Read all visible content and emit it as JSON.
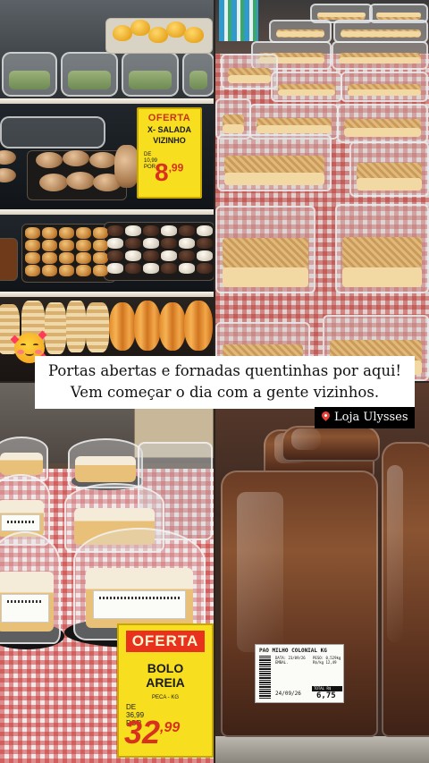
{
  "story": {
    "caption_line1": "Portas abertas e fornadas quentinhas por aqui!",
    "caption_line2": "Vem começar o dia com a gente vizinhos.",
    "location_label": "Loja Ulysses",
    "emoji": "smiling-face-with-hearts"
  },
  "tag_salada": {
    "offer": "OFERTA",
    "name_line1": "X- SALADA",
    "name_line2": "VIZINHO",
    "old_line1": "DE",
    "old_price": "10,99",
    "old_line3": "POR",
    "price_int": "8",
    "price_cents": ",99"
  },
  "tag_bolo": {
    "offer": "OFERTA",
    "name_line1": "BOLO",
    "name_line2": "AREIA",
    "unit": "PECA - KG",
    "old_line1": "DE",
    "old_price": "36,99",
    "old_line3": "POR",
    "price_int": "32",
    "price_cents": ",99"
  },
  "bread_label": {
    "product": "PAO MILHO COLONIAL KG",
    "info_left": "DATA: 23/09/26 EMBAL.",
    "info_right": "PESO: 0,529kg R$/kg 12,49",
    "total_label": "TOTAL R$",
    "total": "6,75",
    "date": "24/09/26"
  },
  "colors": {
    "tag_yellow": "#f7de1f",
    "price_red": "#d8321e",
    "caption_bg": "#ffffff",
    "location_bg": "#000000",
    "pin_red": "#e8413a"
  }
}
